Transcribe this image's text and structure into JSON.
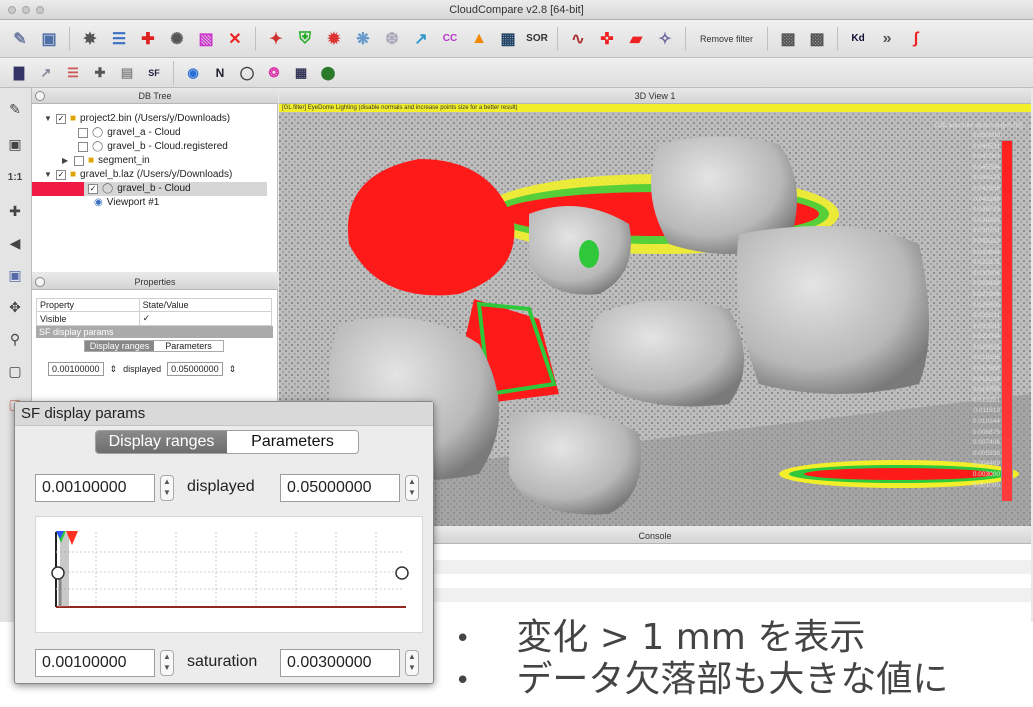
{
  "window": {
    "title": "CloudCompare v2.8 [64-bit]"
  },
  "toolbar1": {
    "icons": [
      "open-icon",
      "save-icon",
      "settings-icon",
      "list-icon",
      "transform-icon",
      "segment-icon",
      "merge-icon",
      "delete-icon",
      "sample-icon",
      "filter-icon",
      "color-icon",
      "noise-icon",
      "cut-icon",
      "compare-icon",
      "c2c-icon",
      "c2m-icon",
      "checker-icon",
      "sor-icon",
      "curve-icon",
      "cross-icon",
      "plane-icon",
      "star-icon"
    ],
    "cc_label": "CC",
    "sor_label": "SOR",
    "remove_filter_label": "Remove filter",
    "kd_label": "Kd",
    "more_label": "»"
  },
  "toolbar2": {
    "sf_label": "SF",
    "n_label": "N",
    "more_label": "»"
  },
  "left_tools": {
    "one_to_one": "1:1"
  },
  "db_tree": {
    "header": "DB Tree",
    "items": [
      {
        "label": "project2.bin (/Users/y/Downloads)",
        "checked": "✓",
        "expanded": "▼"
      },
      {
        "label": "gravel_a - Cloud"
      },
      {
        "label": "gravel_b - Cloud.registered"
      },
      {
        "label": "segment_in",
        "expanded": "▶"
      },
      {
        "label": "gravel_b.laz (/Users/y/Downloads)",
        "checked": "✓",
        "expanded": "▼"
      },
      {
        "label": "gravel_b - Cloud",
        "checked": "✓"
      },
      {
        "label": "Viewport #1"
      }
    ]
  },
  "properties": {
    "header": "Properties",
    "col_property": "Property",
    "col_state": "State/Value",
    "visible_label": "Visible",
    "visible_value": "✓",
    "sf_section": "SF display params",
    "tab_ranges": "Display ranges",
    "tab_parameters": "Parameters",
    "min_value": "0.00100000",
    "displayed_label": "displayed",
    "max_value": "0.05000000"
  },
  "view3d": {
    "header": "3D View 1",
    "warning": "[GL filter] EyeDome Lighting (disable normals and increase points size for a better result)",
    "scale_title": "C2C absolute distances[<0.05]",
    "scale_values": [
      "0.050000",
      "0.048531",
      "0.047063",
      "0.045594",
      "0.044125",
      "0.042656",
      "0.041188",
      "0.039719",
      "0.038250",
      "0.036781",
      "0.035313",
      "0.033844",
      "0.032375",
      "0.030906",
      "0.029438",
      "0.027969",
      "0.026500",
      "0.025031",
      "0.023563",
      "0.022094",
      "0.020625",
      "0.019156",
      "0.017688",
      "0.016219",
      "0.014750",
      "0.013281",
      "0.011813",
      "0.010344",
      "0.008875",
      "0.007406",
      "0.005938",
      "0.004469",
      "0.003000",
      "0.001000"
    ],
    "colors": {
      "high": "#ff1a1a",
      "mid": "#f3e61c",
      "low": "#2fc83a",
      "base": "#1c3cff"
    }
  },
  "console": {
    "header": "Console"
  },
  "popup": {
    "title": "SF display params",
    "tab_ranges": "Display ranges",
    "tab_parameters": "Parameters",
    "min_value": "0.00100000",
    "displayed_label": "displayed",
    "max_value": "0.05000000",
    "sat_min_value": "0.00100000",
    "saturation_label": "saturation",
    "sat_max_value": "0.00300000"
  },
  "notes": {
    "bullet1": "変化 > 1 mm を表示",
    "bullet2": "データ欠落部も大きな値に",
    "bullet_symbol": "•"
  }
}
